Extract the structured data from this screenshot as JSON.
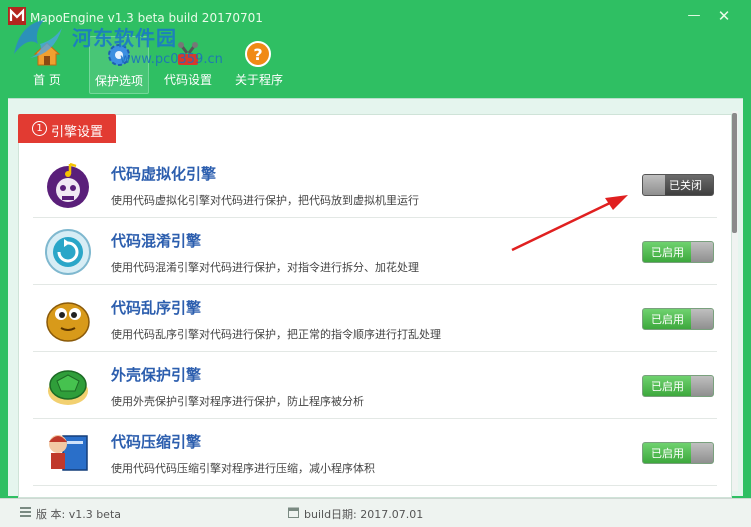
{
  "window": {
    "title": "MapoEngine v1.3 beta build 20170701"
  },
  "watermark": {
    "site": "河东软件园",
    "url": "www.pc0359.cn"
  },
  "toolbar": {
    "items": [
      {
        "label": "首 页",
        "icon": "home-icon"
      },
      {
        "label": "保护选项",
        "icon": "gear-icon",
        "active": true
      },
      {
        "label": "代码设置",
        "icon": "tools-icon"
      },
      {
        "label": "关于程序",
        "icon": "help-icon"
      }
    ]
  },
  "section": {
    "number": "1",
    "label": "引擎设置"
  },
  "engines": [
    {
      "title": "代码虚拟化引擎",
      "desc": "使用代码虚拟化引擎对代码进行保护，把代码放到虚拟机里运行",
      "status": "已关闭",
      "enabled": false,
      "icon": "skull-music-icon"
    },
    {
      "title": "代码混淆引擎",
      "desc": "使用代码混淆引擎对代码进行保护，对指令进行拆分、加花处理",
      "status": "已启用",
      "enabled": true,
      "icon": "refresh-disc-icon"
    },
    {
      "title": "代码乱序引擎",
      "desc": "使用代码乱序引擎对代码进行保护，把正常的指令顺序进行打乱处理",
      "status": "已启用",
      "enabled": true,
      "icon": "blob-face-icon"
    },
    {
      "title": "外壳保护引擎",
      "desc": "使用外壳保护引擎对程序进行保护，防止程序被分析",
      "status": "已启用",
      "enabled": true,
      "icon": "turtle-shell-icon"
    },
    {
      "title": "代码压缩引擎",
      "desc": "使用代码代码压缩引擎对程序进行压缩，减小程序体积",
      "status": "已启用",
      "enabled": true,
      "icon": "compress-book-icon"
    }
  ],
  "statusbar": {
    "version": "版 本: v1.3 beta",
    "build": "build日期: 2017.07.01"
  },
  "colors": {
    "titlebar": "#2fbf63",
    "accent_red": "#e23b32",
    "title_blue": "#2c5eae",
    "toggle_on": "#4cba4c",
    "toggle_off": "#4a4a4a"
  }
}
